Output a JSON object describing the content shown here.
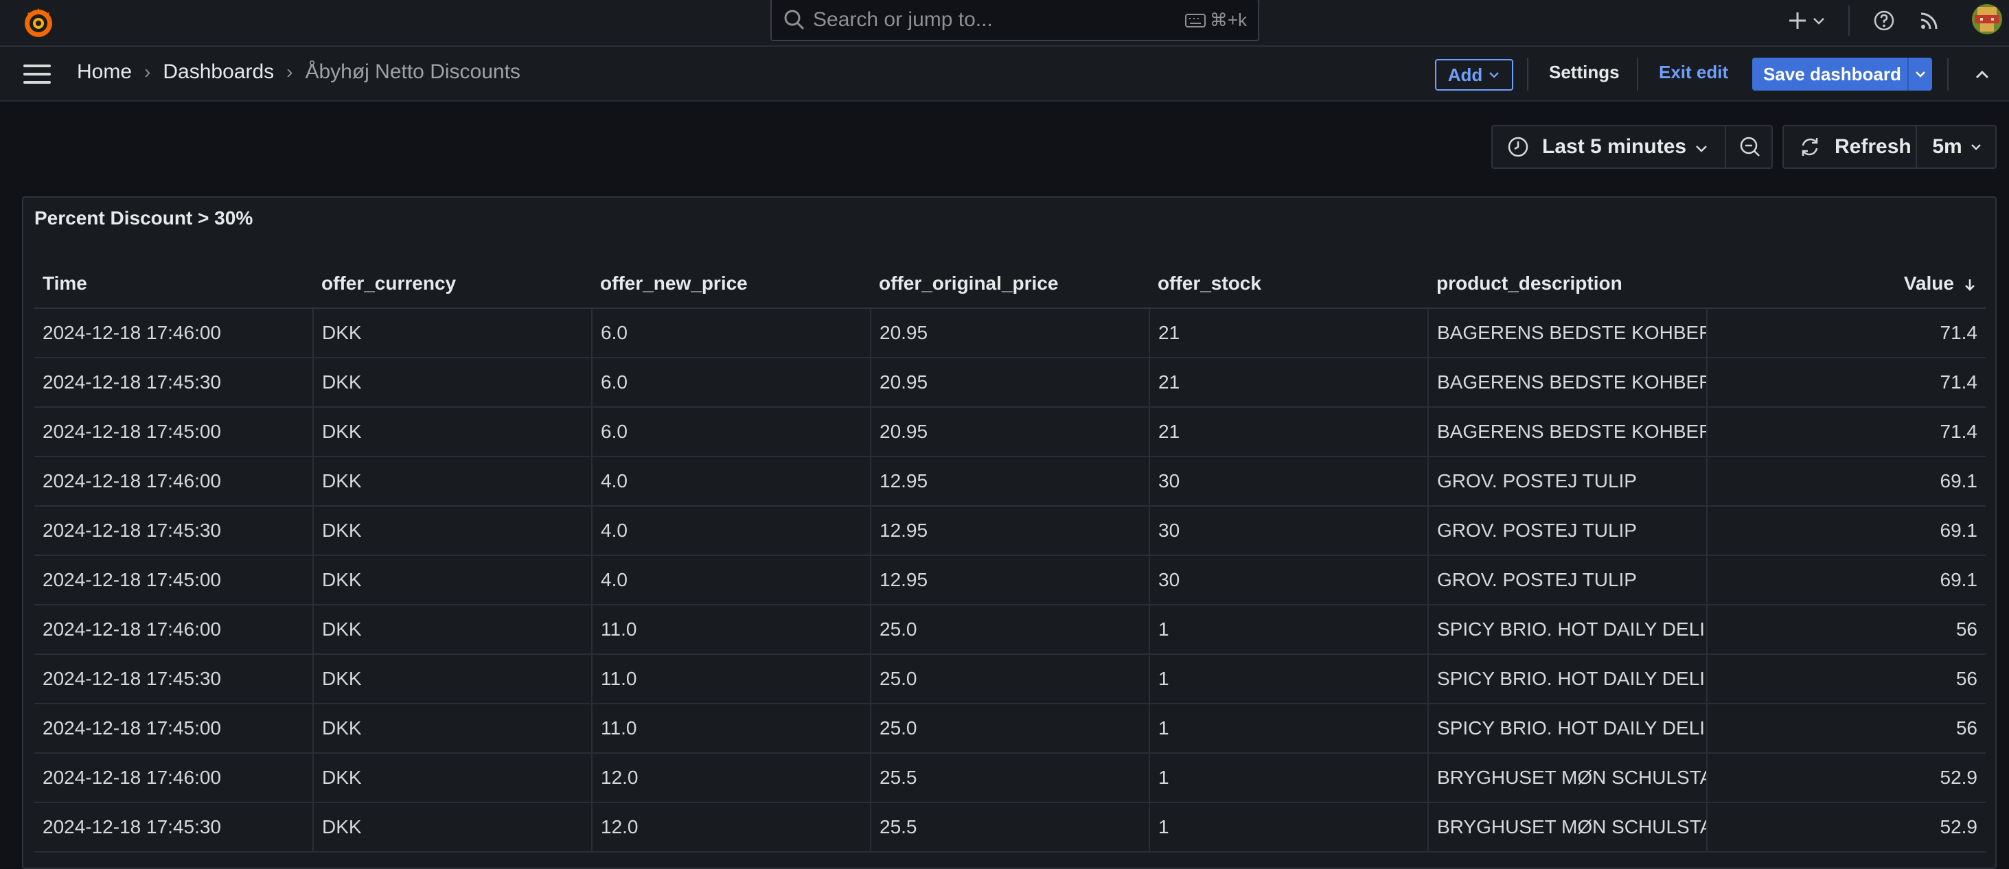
{
  "topbar": {
    "search_placeholder": "Search or jump to...",
    "search_shortcut": "⌘+k",
    "icons": [
      "grafana-logo",
      "plus-icon",
      "help-icon",
      "news-rss-icon",
      "user-avatar"
    ]
  },
  "navbar": {
    "breadcrumbs": [
      "Home",
      "Dashboards",
      "Åbyhøj Netto Discounts"
    ],
    "add_label": "Add",
    "settings_label": "Settings",
    "exit_edit_label": "Exit edit",
    "save_label": "Save dashboard"
  },
  "controls": {
    "time_range": "Last 5 minutes",
    "refresh_label": "Refresh",
    "refresh_interval": "5m"
  },
  "panel": {
    "title": "Percent Discount > 30%",
    "columns": [
      "Time",
      "offer_currency",
      "offer_new_price",
      "offer_original_price",
      "offer_stock",
      "product_description",
      "Value"
    ],
    "sort_column": "Value",
    "sort_direction": "descending",
    "rows": [
      [
        "2024-12-18 17:46:00",
        "DKK",
        "6.0",
        "20.95",
        "21",
        "BAGERENS BEDSTE KOHBERG",
        "71.4"
      ],
      [
        "2024-12-18 17:45:30",
        "DKK",
        "6.0",
        "20.95",
        "21",
        "BAGERENS BEDSTE KOHBERG",
        "71.4"
      ],
      [
        "2024-12-18 17:45:00",
        "DKK",
        "6.0",
        "20.95",
        "21",
        "BAGERENS BEDSTE KOHBERG",
        "71.4"
      ],
      [
        "2024-12-18 17:46:00",
        "DKK",
        "4.0",
        "12.95",
        "30",
        "GROV. POSTEJ TULIP",
        "69.1"
      ],
      [
        "2024-12-18 17:45:30",
        "DKK",
        "4.0",
        "12.95",
        "30",
        "GROV. POSTEJ TULIP",
        "69.1"
      ],
      [
        "2024-12-18 17:45:00",
        "DKK",
        "4.0",
        "12.95",
        "30",
        "GROV. POSTEJ TULIP",
        "69.1"
      ],
      [
        "2024-12-18 17:46:00",
        "DKK",
        "11.0",
        "25.0",
        "1",
        "SPICY BRIO. HOT DAILY DELI",
        "56"
      ],
      [
        "2024-12-18 17:45:30",
        "DKK",
        "11.0",
        "25.0",
        "1",
        "SPICY BRIO. HOT DAILY DELI",
        "56"
      ],
      [
        "2024-12-18 17:45:00",
        "DKK",
        "11.0",
        "25.0",
        "1",
        "SPICY BRIO. HOT DAILY DELI",
        "56"
      ],
      [
        "2024-12-18 17:46:00",
        "DKK",
        "12.0",
        "25.5",
        "1",
        "BRYGHUSET MØN SCHULSTAD",
        "52.9"
      ],
      [
        "2024-12-18 17:45:30",
        "DKK",
        "12.0",
        "25.5",
        "1",
        "BRYGHUSET MØN SCHULSTAD",
        "52.9"
      ]
    ]
  }
}
